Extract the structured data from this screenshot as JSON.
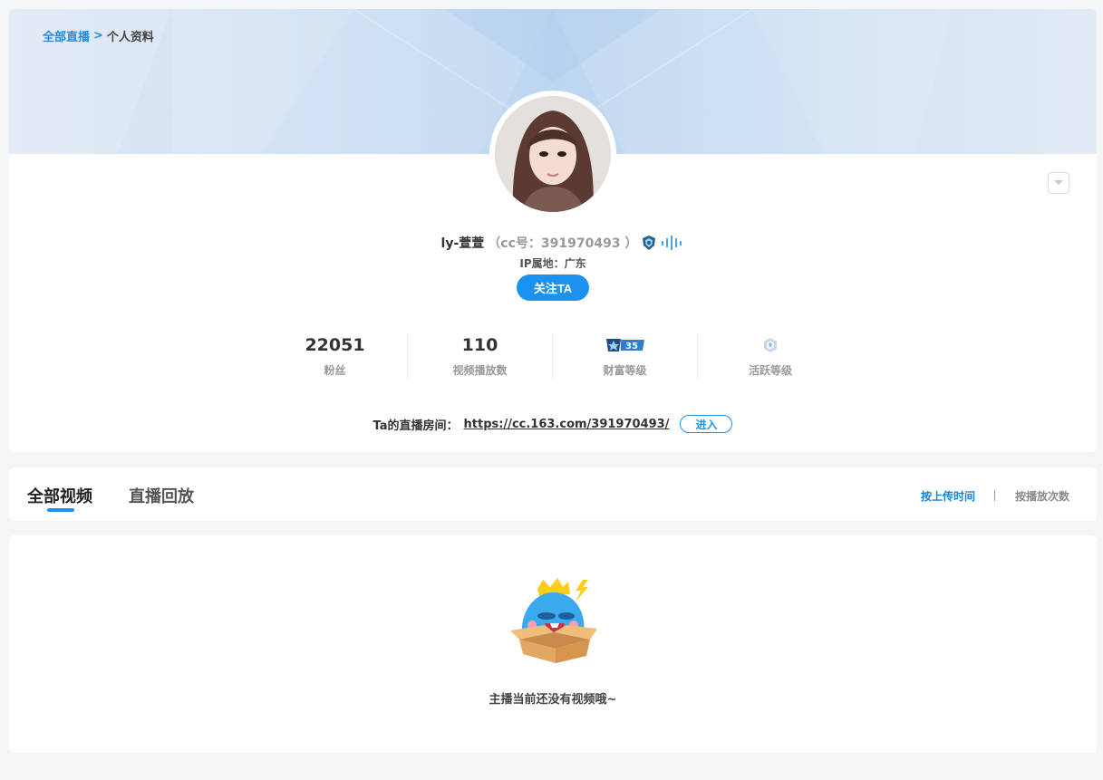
{
  "breadcrumb": {
    "root": "全部直播",
    "separator": ">",
    "current": "个人资料"
  },
  "profile": {
    "nickname": "ly-萱萱",
    "cc_label": "（cc号：391970493 ）",
    "ip_location": "IP属地：广东",
    "follow_label": "关注TA",
    "wealth_level_badge": "35"
  },
  "stats": [
    {
      "value": "22051",
      "label": "粉丝"
    },
    {
      "value": "110",
      "label": "视频播放数"
    },
    {
      "value": "",
      "label": "财富等级"
    },
    {
      "value": "",
      "label": "活跃等级"
    }
  ],
  "room": {
    "prefix": "Ta的直播房间：",
    "url": "https://cc.163.com/391970493/",
    "enter_label": "进入"
  },
  "tabs": [
    {
      "label": "全部视频",
      "active": true
    },
    {
      "label": "直播回放",
      "active": false
    }
  ],
  "sort": {
    "by_upload": "按上传时间",
    "divider": "|",
    "by_plays": "按播放次数"
  },
  "empty": {
    "message": "主播当前还没有视频哦~"
  },
  "colors": {
    "accent": "#1a92f0",
    "page_bg": "#f4f5f7"
  }
}
